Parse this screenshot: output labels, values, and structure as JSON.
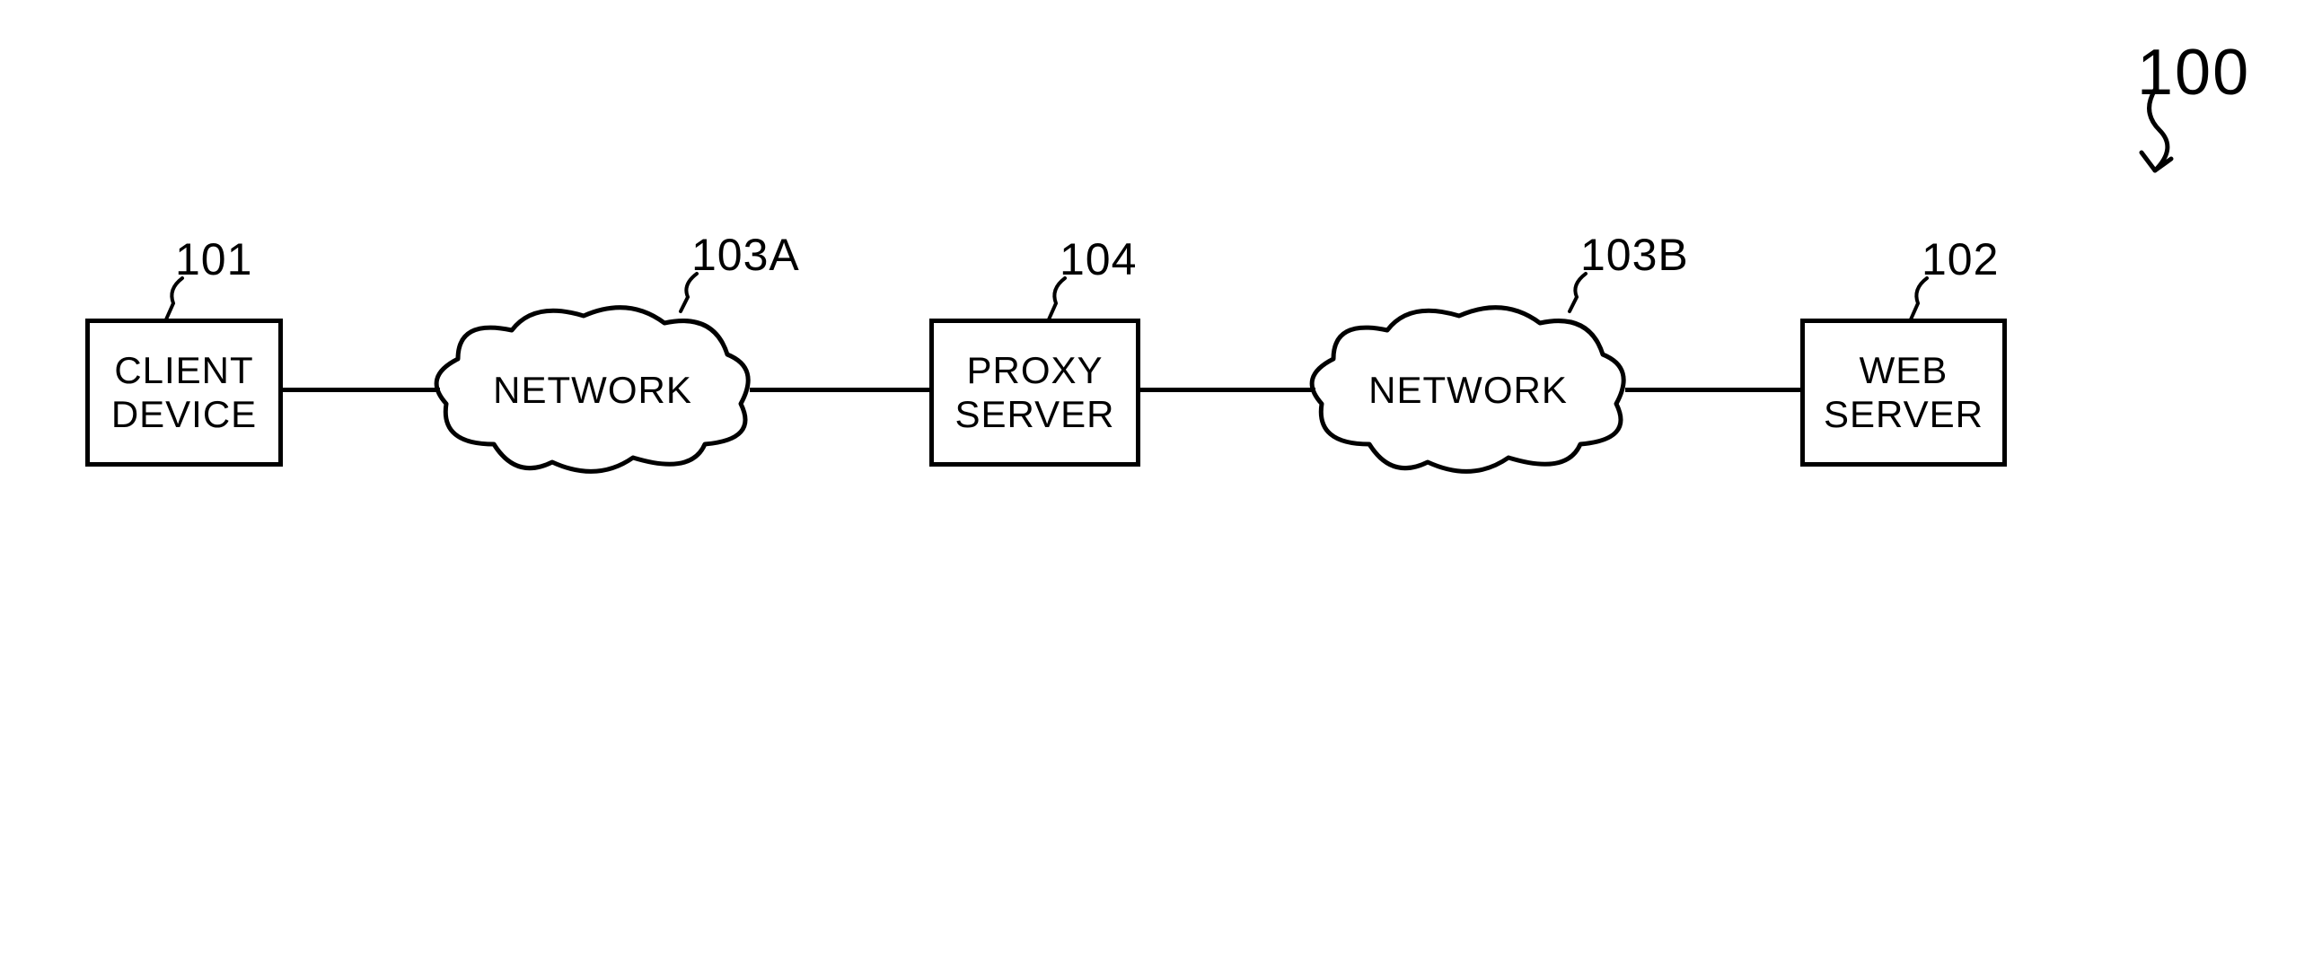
{
  "figure": {
    "ref": "100"
  },
  "nodes": {
    "client": {
      "label": "CLIENT\nDEVICE",
      "ref": "101"
    },
    "networkA": {
      "label": "NETWORK",
      "ref": "103A"
    },
    "proxy": {
      "label": "PROXY\nSERVER",
      "ref": "104"
    },
    "networkB": {
      "label": "NETWORK",
      "ref": "103B"
    },
    "web": {
      "label": "WEB\nSERVER",
      "ref": "102"
    }
  }
}
